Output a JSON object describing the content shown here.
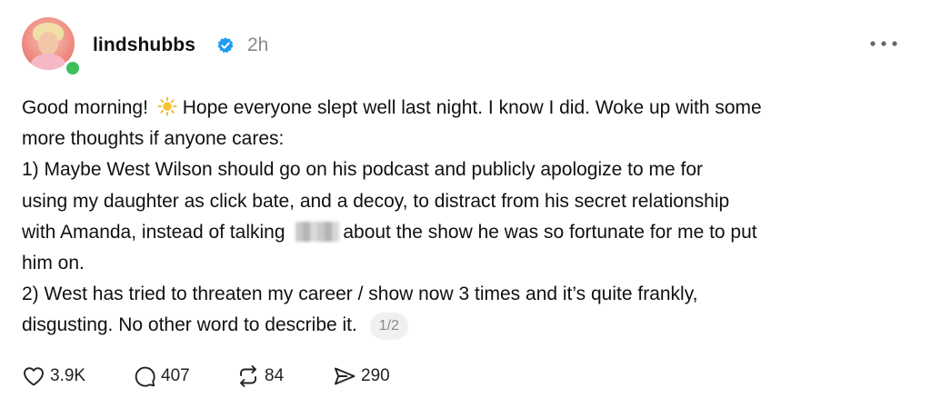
{
  "post": {
    "username": "lindshubbs",
    "verified_icon": "verified-badge-icon",
    "timestamp": "2h",
    "text_lines": [
      [
        "Good morning! ",
        "Hope everyone slept well last night. I know I did. Woke up with some"
      ],
      [
        "more thoughts if anyone cares:"
      ],
      [
        "1) Maybe West Wilson should go on his podcast and publicly apologize to me for"
      ],
      [
        "using my daughter as click bate, and a decoy, to distract from his secret relationship"
      ],
      [
        "with Amanda, instead of talking ",
        "about the show he was so fortunate for me to put"
      ],
      [
        "him on."
      ],
      [
        "2) West has tried to threaten my career / show now 3 times and it’s quite frankly,"
      ],
      [
        "disgusting. No other word to describe it. "
      ]
    ],
    "page_indicator": "1/2"
  },
  "actions": {
    "likes": "3.9K",
    "comments": "407",
    "reposts": "84",
    "shares": "290"
  },
  "colors": {
    "online": "#3cc05a",
    "verified": "#1d9bf0",
    "muted": "#8a8a8a"
  }
}
